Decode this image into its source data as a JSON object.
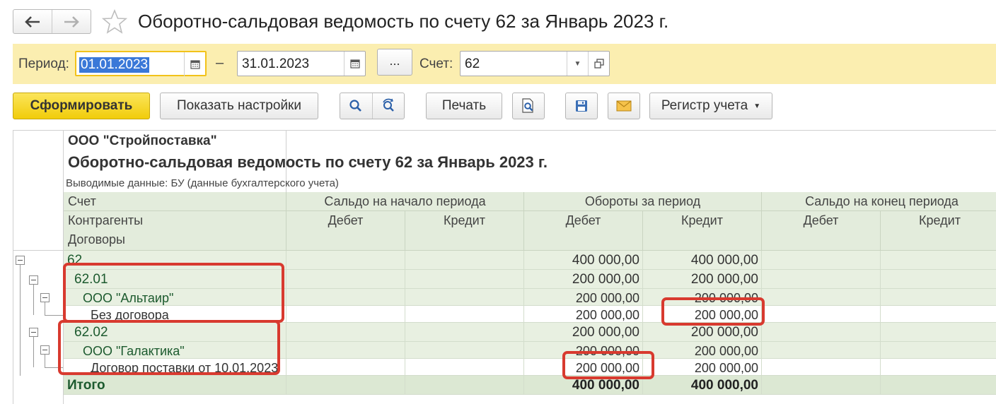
{
  "window": {
    "title": "Оборотно-сальдовая ведомость по счету 62 за Январь 2023 г.",
    "back_icon": "arrow-left",
    "forward_icon": "arrow-right",
    "favorite_icon": "star"
  },
  "params": {
    "period_label": "Период:",
    "date_from": "01.01.2023",
    "separator": "–",
    "date_to": "31.01.2023",
    "period_choose": "...",
    "account_label": "Счет:",
    "account_value": "62"
  },
  "toolbar": {
    "generate": "Сформировать",
    "show_settings": "Показать настройки",
    "print": "Печать",
    "register": "Регистр учета"
  },
  "report": {
    "organization": "ООО \"Стройпоставка\"",
    "title": "Оборотно-сальдовая ведомость по счету 62 за Январь 2023 г.",
    "note": "Выводимые данные: БУ (данные бухгалтерского учета)",
    "header": {
      "group_rows": [
        "Счет",
        "Контрагенты",
        "Договоры"
      ],
      "opening": "Сальдо на начало периода",
      "turnover": "Обороты за период",
      "closing": "Сальдо на конец периода",
      "debit": "Дебет",
      "credit": "Кредит"
    },
    "rows": [
      {
        "name": "62",
        "od": "",
        "oc": "",
        "td": "400 000,00",
        "tc": "400 000,00",
        "cd": "",
        "cc": ""
      },
      {
        "name": "62.01",
        "od": "",
        "oc": "",
        "td": "200 000,00",
        "tc": "200 000,00",
        "cd": "",
        "cc": ""
      },
      {
        "name": "ООО \"Альтаир\"",
        "od": "",
        "oc": "",
        "td": "200 000,00",
        "tc": "200 000,00",
        "cd": "",
        "cc": ""
      },
      {
        "name": "Без договора",
        "od": "",
        "oc": "",
        "td": "200 000,00",
        "tc": "200 000,00",
        "cd": "",
        "cc": ""
      },
      {
        "name": "62.02",
        "od": "",
        "oc": "",
        "td": "200 000,00",
        "tc": "200 000,00",
        "cd": "",
        "cc": ""
      },
      {
        "name": "ООО \"Галактика\"",
        "od": "",
        "oc": "",
        "td": "200 000,00",
        "tc": "200 000,00",
        "cd": "",
        "cc": ""
      },
      {
        "name": "Договор поставки от 10.01.2023",
        "od": "",
        "oc": "",
        "td": "200 000,00",
        "tc": "200 000,00",
        "cd": "",
        "cc": ""
      }
    ],
    "total": {
      "name": "Итого",
      "td": "400 000,00",
      "tc": "400 000,00"
    }
  },
  "colors": {
    "param_bar": "#fbeeb0",
    "primary_button": "#f1cc0a",
    "header_bg": "#e3ecdc",
    "group_row_bg": "#e8f0e1",
    "name_text": "#1c5a2e",
    "highlight": "#d83a2f"
  }
}
